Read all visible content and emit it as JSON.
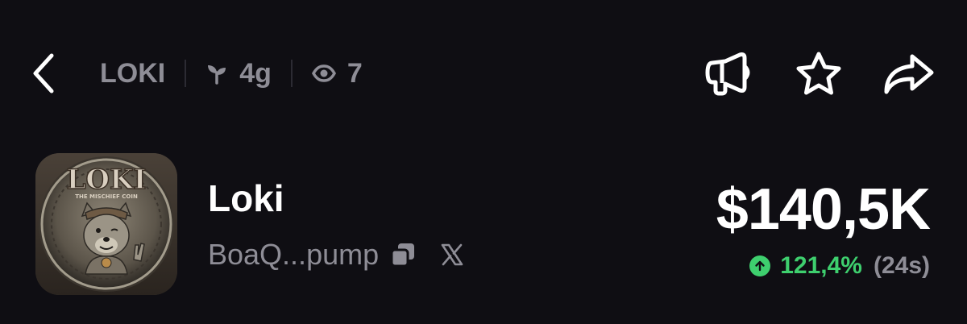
{
  "header": {
    "ticker": "LOKI",
    "age": "4g",
    "age_icon": "sprout-icon",
    "watchers": "7",
    "watchers_icon": "eye-icon",
    "actions": [
      {
        "name": "megaphone-icon"
      },
      {
        "name": "star-icon"
      },
      {
        "name": "share-icon"
      }
    ]
  },
  "token": {
    "name": "Loki",
    "address": "BoaQ...pump",
    "price": "$140,5K",
    "change_pct": "121,4%",
    "change_period": "(24s)",
    "coin_text": "LOKI",
    "coin_subtext": "THE MISCHIEF COIN"
  },
  "colors": {
    "background": "#0f0e13",
    "muted_text": "#8e8d96",
    "positive": "#3ecf6e"
  }
}
